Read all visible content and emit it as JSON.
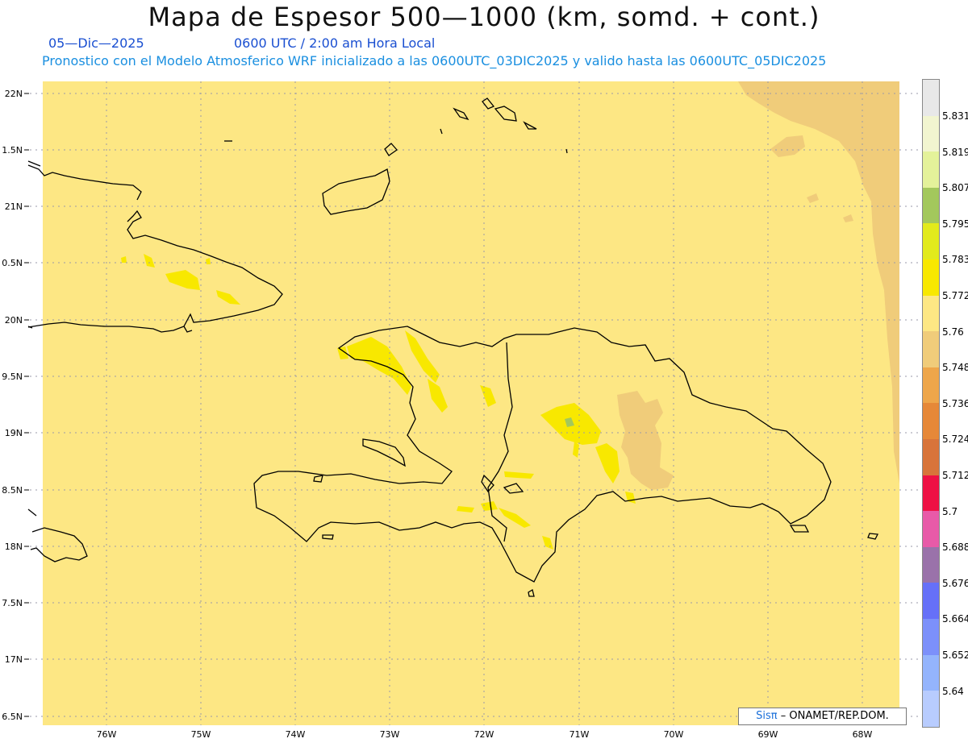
{
  "header": {
    "title": "Mapa de Espesor 500—1000 (km, somd. + cont.)",
    "date": "05—Dic—2025",
    "time": "0600 UTC / 2:00 am Hora Local",
    "description": "Pronostico con el Modelo Atmosferico WRF inicializado a las 0600UTC_03DIC2025 y valido hasta las  0600UTC_05DIC2025"
  },
  "map": {
    "lat_labels": [
      "22N",
      "1.5N",
      "21N",
      "0.5N",
      "20N",
      "9.5N",
      "19N",
      "8.5N",
      "18N",
      "7.5N",
      "17N",
      "6.5N"
    ],
    "lon_labels": [
      "76W",
      "75W",
      "74W",
      "73W",
      "72W",
      "71W",
      "70W",
      "69W",
      "68W"
    ],
    "background_color": "#fde784",
    "coast_color": "#000000",
    "grid_color": "#9a9aa8"
  },
  "colorbar": {
    "labels": [
      "5.831",
      "5.819",
      "5.807",
      "5.795",
      "5.783",
      "5.772",
      "5.76",
      "5.748",
      "5.736",
      "5.724",
      "5.712",
      "5.7",
      "5.688",
      "5.676",
      "5.664",
      "5.652",
      "5.64"
    ],
    "colors": [
      "#e8e8e8",
      "#f2f5d0",
      "#e4f29a",
      "#a3c85c",
      "#e2ea1c",
      "#f8e800",
      "#fde784",
      "#f0cc7a",
      "#eea64a",
      "#e68838",
      "#d8743a",
      "#ee1144",
      "#e85aa8",
      "#9a72aa",
      "#6670f8",
      "#7c90fa",
      "#94b4fc",
      "#b8ccfe"
    ]
  },
  "credit": {
    "brand": "Sisπ",
    "text": "– ONAMET/REP.DOM."
  }
}
